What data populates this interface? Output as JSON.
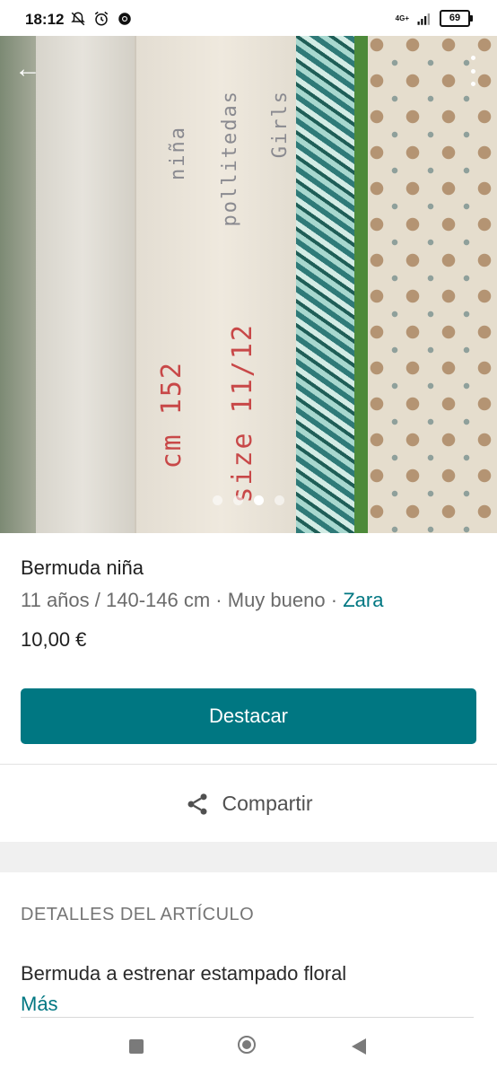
{
  "status_bar": {
    "time": "18:12",
    "network": "4G+",
    "battery": "69",
    "icons": [
      "notifications-off-icon",
      "alarm-icon",
      "chrome-icon",
      "signal-icon",
      "battery-icon"
    ]
  },
  "hero": {
    "image_count": 4,
    "active_index": 2,
    "label_text_lines": [
      "Girls",
      "pollitedas",
      "niña",
      "size 11/12",
      "cm 152"
    ],
    "icons": {
      "back": "arrow-left-icon",
      "more": "more-vertical-icon"
    }
  },
  "product": {
    "title": "Bermuda niña",
    "size": "11 años / 140-146 cm",
    "separator": "·",
    "condition": "Muy bueno",
    "brand": "Zara",
    "price": "10,00 €"
  },
  "actions": {
    "primary_button": "Destacar",
    "share_label": "Compartir",
    "share_icon": "share-icon"
  },
  "details": {
    "heading": "DETALLES DEL ARTÍCULO",
    "description": "Bermuda a estrenar estampado floral",
    "more_link": "Más"
  },
  "colors": {
    "accent": "#007782",
    "text_primary": "#1f1f1f",
    "text_secondary": "#6b6b6b"
  },
  "navbar": {
    "icons": [
      "recents-square-icon",
      "home-circle-icon",
      "back-triangle-icon"
    ]
  }
}
